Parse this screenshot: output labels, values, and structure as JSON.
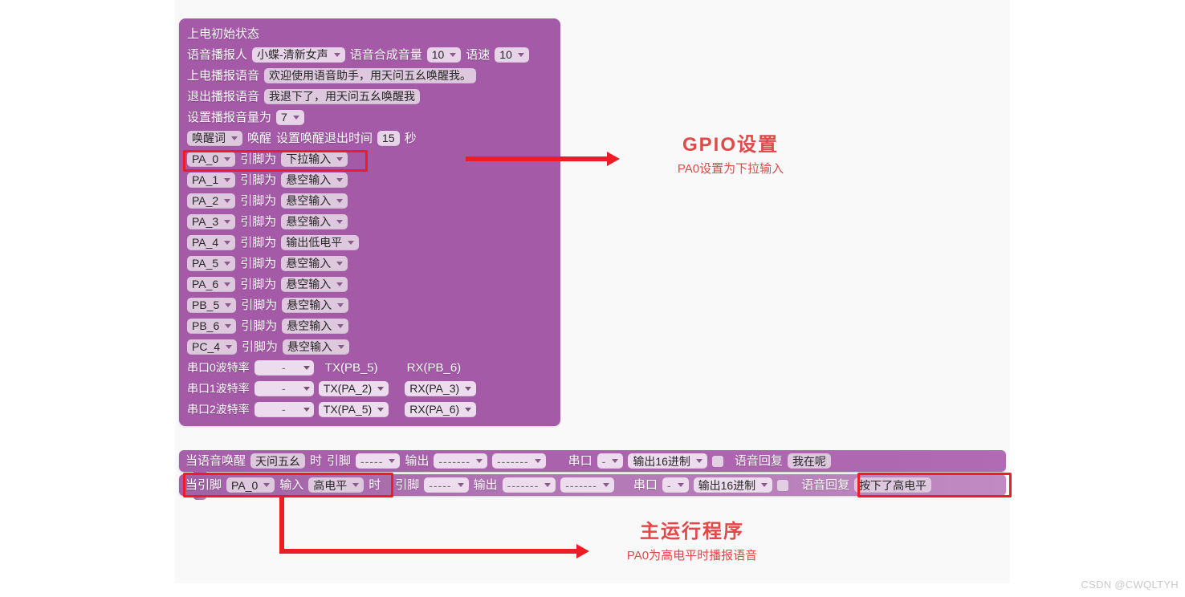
{
  "watermark": "CSDN @CWQLTYH",
  "init_block": {
    "title": "上电初始状态",
    "speaker": {
      "label": "语音播报人",
      "value": "小蝶-清新女声"
    },
    "tts_volume": {
      "label": "语音合成音量",
      "value": "10"
    },
    "speed": {
      "label": "语速",
      "value": "10"
    },
    "boot_voice": {
      "label": "上电播报语音",
      "value": "欢迎使用语音助手，用天问五幺唤醒我。"
    },
    "exit_voice": {
      "label": "退出播报语音",
      "value": "我退下了，用天问五幺唤醒我"
    },
    "play_volume": {
      "label": "设置播报音量为",
      "value": "7"
    },
    "wake": {
      "mode": "唤醒词",
      "verb": "唤醒",
      "timeout_label": "设置唤醒退出时间",
      "timeout_value": "15",
      "unit": "秒"
    },
    "pin_verb": "引脚为",
    "pins": [
      {
        "pin": "PA_0",
        "mode": "下拉输入",
        "highlight": true
      },
      {
        "pin": "PA_1",
        "mode": "悬空输入",
        "highlight": false
      },
      {
        "pin": "PA_2",
        "mode": "悬空输入",
        "highlight": false
      },
      {
        "pin": "PA_3",
        "mode": "悬空输入",
        "highlight": false
      },
      {
        "pin": "PA_4",
        "mode": "输出低电平",
        "highlight": false
      },
      {
        "pin": "PA_5",
        "mode": "悬空输入",
        "highlight": false
      },
      {
        "pin": "PA_6",
        "mode": "悬空输入",
        "highlight": false
      },
      {
        "pin": "PB_5",
        "mode": "悬空输入",
        "highlight": false
      },
      {
        "pin": "PB_6",
        "mode": "悬空输入",
        "highlight": false
      },
      {
        "pin": "PC_4",
        "mode": "悬空输入",
        "highlight": false
      }
    ],
    "serials": [
      {
        "label": "串口0波特率",
        "baud": "-",
        "tx": "TX(PB_5)",
        "rx": "RX(PB_6)",
        "dropdown": false
      },
      {
        "label": "串口1波特率",
        "baud": "-",
        "tx": "TX(PA_2)",
        "rx": "RX(PA_3)",
        "dropdown": true
      },
      {
        "label": "串口2波特率",
        "baud": "-",
        "tx": "TX(PA_5)",
        "rx": "RX(PA_6)",
        "dropdown": true
      }
    ]
  },
  "event_blocks": [
    {
      "prefix": "当语音唤醒",
      "trigger": "天问五幺",
      "when": "时",
      "pin_label": "引脚",
      "pin_value": "-----",
      "out_label": "输出",
      "out_value": "-------",
      "out_value2": "-------",
      "serial_label": "串口",
      "serial_value": "-",
      "hex_label": "输出16进制",
      "reply_label": "语音回复",
      "reply_value": "我在呢"
    },
    {
      "prefix": "当引脚",
      "trigger": "PA_0",
      "input_label": "输入",
      "input_value": "高电平",
      "when": "时",
      "pin_label": "引脚",
      "pin_value": "-----",
      "out_label": "输出",
      "out_value": "-------",
      "out_value2": "-------",
      "serial_label": "串口",
      "serial_value": "-",
      "hex_label": "输出16进制",
      "reply_label": "语音回复",
      "reply_value": "按下了高电平"
    }
  ],
  "annotations": [
    {
      "title": "GPIO设置",
      "subtitle": "PA0设置为下拉输入"
    },
    {
      "title": "主运行程序",
      "subtitle": "PA0为高电平时播报语音"
    }
  ],
  "colors": {
    "block": "#a55aa8",
    "field": "#e8d4e9",
    "highlight": "#ee1c24",
    "annotation": "#e24848",
    "canvas": "#f9f9f9"
  }
}
